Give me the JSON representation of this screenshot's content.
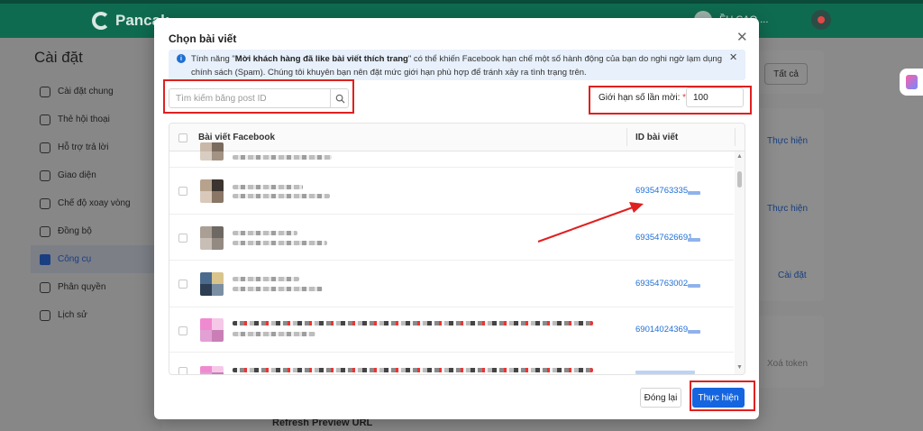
{
  "app": {
    "brand": "Pancak",
    "user_name": "ỀU CAO ..."
  },
  "sidebar": {
    "title": "Cài đặt",
    "items": [
      {
        "label": "Cài đặt chung",
        "icon": "gear-icon"
      },
      {
        "label": "Thẻ hội thoại",
        "icon": "tag-icon"
      },
      {
        "label": "Hỗ trợ trả lời",
        "icon": "chat-icon"
      },
      {
        "label": "Giao diện",
        "icon": "monitor-icon"
      },
      {
        "label": "Chế độ xoay vòng",
        "icon": "rotate-icon"
      },
      {
        "label": "Đồng bộ",
        "icon": "cloud-icon"
      },
      {
        "label": "Công cụ",
        "icon": "wrench-icon",
        "active": true
      },
      {
        "label": "Phân quyền",
        "icon": "users-icon"
      },
      {
        "label": "Lịch sử",
        "icon": "history-icon"
      }
    ]
  },
  "background": {
    "all_button": "Tất cả",
    "action1": "Thực hiện",
    "action2": "Thực hiện",
    "settings": "Cài đặt",
    "delete_token": "Xoá token",
    "refresh": "Refresh Preview URL"
  },
  "modal": {
    "title": "Chọn bài viết",
    "alert": {
      "prefix": "Tính năng \"",
      "bold": "Mời khách hàng đã like bài viết thích trang",
      "suffix": "\" có thể khiến Facebook hạn chế một số hành động của bạn do nghi ngờ lạm dụng chính sách (Spam). Chúng tôi khuyên bạn nên đặt mức giới hạn phù hợp để tránh xảy ra tình trạng trên."
    },
    "search_placeholder": "Tìm kiếm bằng post ID",
    "limit_label": "Giới hạn số lần mời:",
    "limit_value": "100",
    "table": {
      "col_post": "Bài viết Facebook",
      "col_id": "ID bài viết",
      "rows": [
        {
          "id": "69354763335"
        },
        {
          "id": "693547626691"
        },
        {
          "id": "69354763002"
        },
        {
          "id": "69014024369"
        }
      ]
    },
    "buttons": {
      "close": "Đóng lại",
      "submit": "Thực hiện"
    }
  },
  "colors": {
    "accent": "#1565e0",
    "highlight": "#e02020",
    "header": "#0f6b50"
  }
}
